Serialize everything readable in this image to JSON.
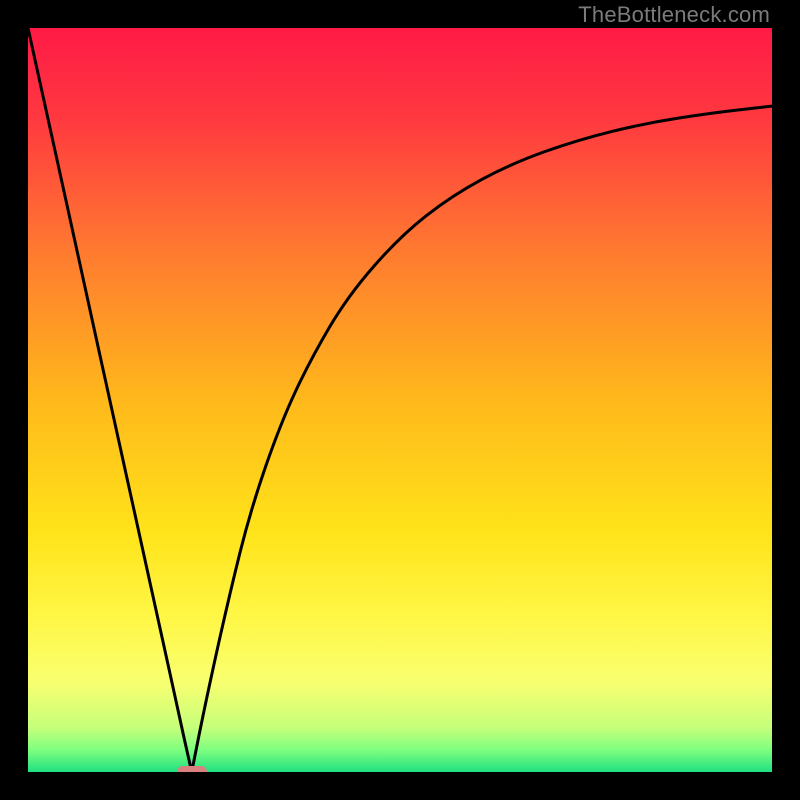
{
  "watermark": "TheBottleneck.com",
  "chart_data": {
    "type": "line",
    "title": "",
    "xlabel": "",
    "ylabel": "",
    "xlim": [
      0,
      1
    ],
    "ylim": [
      0,
      1
    ],
    "gradient_stops": [
      {
        "pos": 0.0,
        "color": "#ff1a46"
      },
      {
        "pos": 0.12,
        "color": "#ff3840"
      },
      {
        "pos": 0.3,
        "color": "#ff7a30"
      },
      {
        "pos": 0.5,
        "color": "#ffb81b"
      },
      {
        "pos": 0.68,
        "color": "#ffe41a"
      },
      {
        "pos": 0.8,
        "color": "#fff84a"
      },
      {
        "pos": 0.88,
        "color": "#f8ff70"
      },
      {
        "pos": 0.94,
        "color": "#c6ff7a"
      },
      {
        "pos": 0.97,
        "color": "#80ff80"
      },
      {
        "pos": 1.0,
        "color": "#20e080"
      }
    ],
    "series": [
      {
        "name": "left-branch",
        "x": [
          0.0,
          0.05,
          0.1,
          0.15,
          0.19,
          0.21,
          0.22
        ],
        "values": [
          1.0,
          0.773,
          0.545,
          0.318,
          0.136,
          0.045,
          0.0
        ]
      },
      {
        "name": "right-branch",
        "x": [
          0.22,
          0.24,
          0.27,
          0.3,
          0.34,
          0.38,
          0.43,
          0.5,
          0.57,
          0.65,
          0.74,
          0.83,
          0.92,
          1.0
        ],
        "values": [
          0.0,
          0.1,
          0.235,
          0.355,
          0.47,
          0.555,
          0.64,
          0.72,
          0.775,
          0.818,
          0.85,
          0.872,
          0.886,
          0.895
        ]
      }
    ],
    "marker": {
      "x": 0.22,
      "y": 0.0,
      "color": "#d98080"
    }
  }
}
